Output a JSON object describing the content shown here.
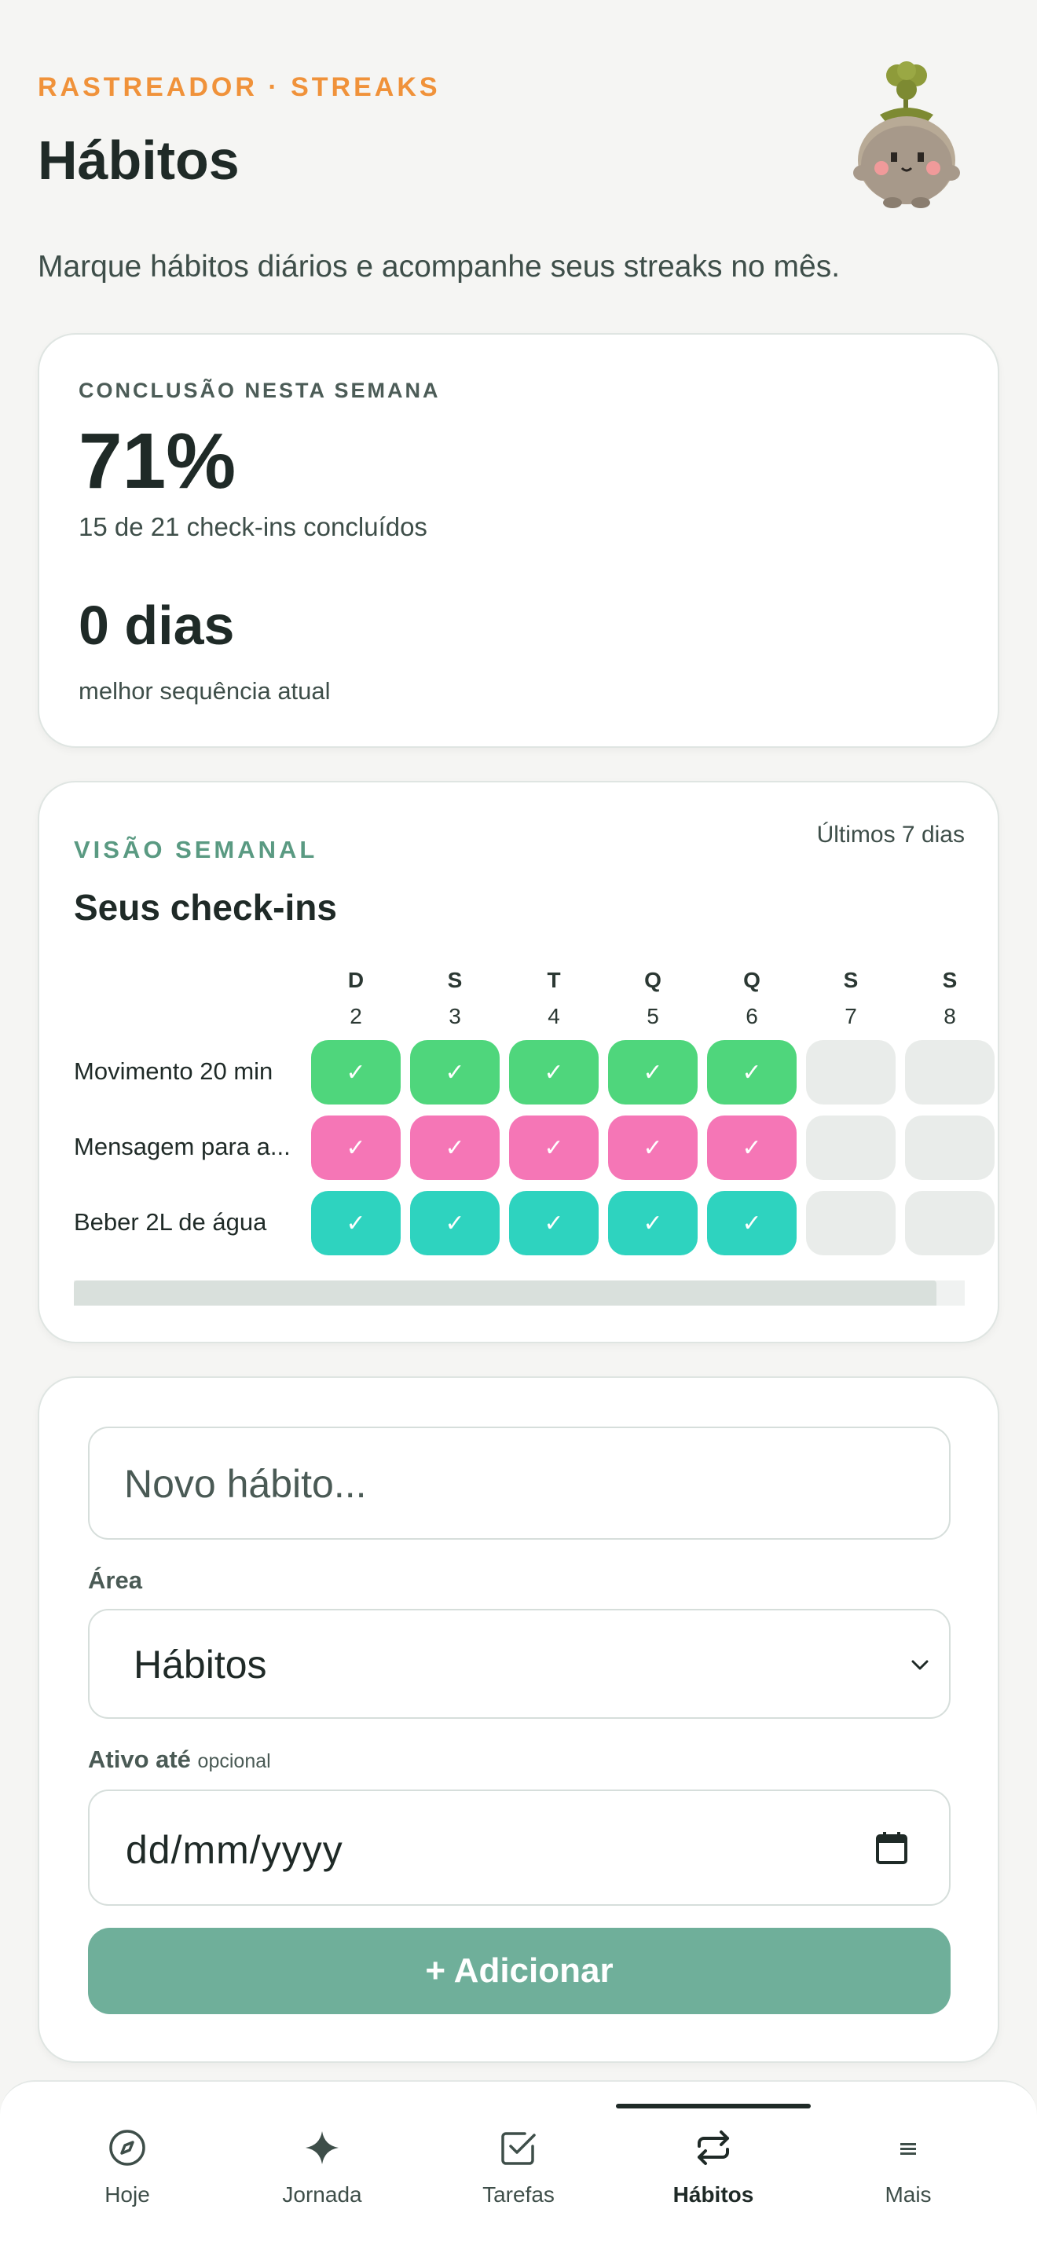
{
  "header": {
    "eyebrow": "RASTREADOR · STREAKS",
    "title": "Hábitos",
    "subtitle": "Marque hábitos diários e acompanhe seus streaks no mês."
  },
  "summary": {
    "eyebrow": "CONCLUSÃO NESTA SEMANA",
    "percent": "71%",
    "detail": "15 de 21 check-ins concluídos",
    "streak": "0 dias",
    "streak_label": "melhor sequência atual"
  },
  "weekly": {
    "eyebrow": "VISÃO SEMANAL",
    "range": "Últimos 7 dias",
    "title": "Seus check-ins",
    "days": [
      {
        "letter": "D",
        "num": "2"
      },
      {
        "letter": "S",
        "num": "3"
      },
      {
        "letter": "T",
        "num": "4"
      },
      {
        "letter": "Q",
        "num": "5"
      },
      {
        "letter": "Q",
        "num": "6"
      },
      {
        "letter": "S",
        "num": "7"
      },
      {
        "letter": "S",
        "num": "8"
      }
    ],
    "habits": [
      {
        "name": "Movimento 20 min",
        "color": "#4fd67c",
        "done": [
          true,
          true,
          true,
          true,
          true,
          false,
          false
        ]
      },
      {
        "name": "Mensagem para a...",
        "color": "#f576b6",
        "done": [
          true,
          true,
          true,
          true,
          true,
          false,
          false
        ]
      },
      {
        "name": "Beber 2L de água",
        "color": "#2ed3bf",
        "done": [
          true,
          true,
          true,
          true,
          true,
          false,
          false
        ]
      }
    ],
    "check_mark": "✓"
  },
  "form": {
    "habit_placeholder": "Novo hábito...",
    "area_label": "Área",
    "area_value": "Hábitos",
    "active_label": "Ativo até",
    "active_optional": "opcional",
    "date_placeholder": "dd/mm/yyyy",
    "add_label": "+ Adicionar"
  },
  "nav": {
    "items": [
      {
        "label": "Hoje",
        "icon": "compass-icon"
      },
      {
        "label": "Jornada",
        "icon": "sparkle-icon"
      },
      {
        "label": "Tarefas",
        "icon": "checkbox-icon"
      },
      {
        "label": "Hábitos",
        "icon": "repeat-icon"
      },
      {
        "label": "Mais",
        "icon": "menu-icon"
      }
    ],
    "active": "Hábitos"
  },
  "colors": {
    "accent_orange": "#f0923a",
    "accent_green": "#5a9a82",
    "button_green": "#6faf9a"
  }
}
